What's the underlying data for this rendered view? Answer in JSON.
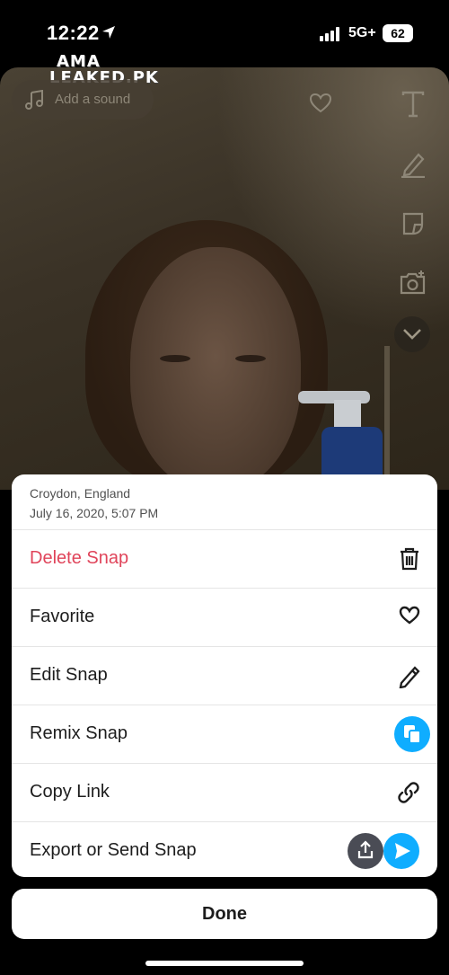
{
  "status_bar": {
    "time": "12:22",
    "network": "5G+",
    "battery": "62"
  },
  "watermark": {
    "line1": "AMA",
    "line2": "LEAKED.PK"
  },
  "snap": {
    "sound_placeholder": "Add a sound",
    "tools": [
      "music-note-icon",
      "heart-icon",
      "text-icon",
      "pencil-icon",
      "sticker-icon",
      "camera-icon",
      "chevron-down-icon"
    ]
  },
  "sheet": {
    "location": "Croydon, England",
    "date": "July 16, 2020, 5:07 PM",
    "items": [
      {
        "label": "Delete Snap",
        "icon": "trash-icon",
        "color": "#e0445a"
      },
      {
        "label": "Favorite",
        "icon": "heart-icon"
      },
      {
        "label": "Edit Snap",
        "icon": "pencil-icon"
      },
      {
        "label": "Remix Snap",
        "icon": "remix-icon",
        "color": "#0fadff"
      },
      {
        "label": "Copy Link",
        "icon": "link-icon"
      },
      {
        "label": "Export or Send Snap",
        "icon": "export-send-icon"
      }
    ]
  },
  "done_label": "Done",
  "colors": {
    "accent": "#0fadff",
    "danger": "#e0445a"
  }
}
